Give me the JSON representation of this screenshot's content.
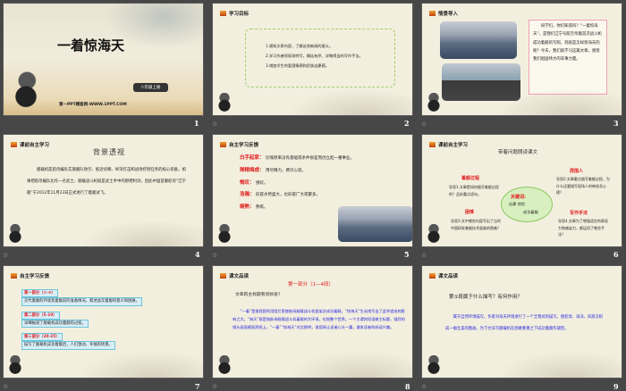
{
  "slides": [
    {
      "number": "1",
      "title": "一着惊海天",
      "grade": "八年级上册",
      "footer": "第一PPT模板网-WWW.1PPT.COM"
    },
    {
      "number": "2",
      "header": "学习目标",
      "items": [
        "1.感知文章内容，了解这则新闻的意义。",
        "2.学习作者抓现场特写，概括有序、详略得当的写作手法。",
        "3.增加学生的爱国情感和民族自豪感。"
      ]
    },
    {
      "number": "3",
      "header": "情景导入",
      "text": "同学们，你们知道吗？“一着惊海天”，是我们辽宁号航空母舰首次战斗机成功着舰的写照，到底是怎样惊海天的呢？今天，我们就学习这篇文章，感受我们祖国伟大的军事力量。"
    },
    {
      "number": "4",
      "header": "课前自主学习",
      "title": "背景透视",
      "text": "舰载机是航母编队实施舰队防空、抵近侦察、纵深打击和战场控制任务的核心装备，如果把航母编队比作一名武士，舰载战斗机就是武士手中的那把利剑，因此中国首艘航母“辽宁舰”于2012年11月23日正式进行了着舰试飞。"
    },
    {
      "number": "5",
      "header": "自主学习反馈",
      "terms": [
        {
          "term": "白手起家：",
          "def": "比喻原来没有基础或条件很差而创立起一番事业。"
        },
        {
          "term": "殚精竭虑：",
          "def": "用尽精力，费尽心思。"
        },
        {
          "term": "慨叹：",
          "def": "感叹。"
        },
        {
          "term": "浩瀚：",
          "def": "形容水势盛大，也形容广大或繁多。"
        },
        {
          "term": "娴熟：",
          "def": "熟练。"
        }
      ]
    },
    {
      "number": "6",
      "header": "课前自主学习",
      "title": "带着问题朗读课文",
      "center": "关键词:",
      "keys": [
        "自豪",
        "惊险",
        "成功",
        "着舰"
      ],
      "branches": [
        {
          "label": "着舰过程",
          "q": "导思1.文章是如何描写着舰过程的？品析重点语句。"
        },
        {
          "label": "周围人",
          "q": "导思2:文章重点描写着舰过程，为什么还要描写现场人的神态及心理？"
        },
        {
          "label": "困难",
          "q": "导思3.文中哪些内容写出了当时中国研发着舰技术面临的困难？"
        },
        {
          "label": "写作手法",
          "q": "导思4.文章为了增强语言的表现力和感染力，都运用了哪些手法？"
        }
      ]
    },
    {
      "number": "7",
      "header": "自主学习反馈",
      "parts": [
        {
          "label": "第一部分（①-④）",
          "desc": "交代着舰的环境及着舰前的准备情况，叙述此次着舰的意义和困难。"
        },
        {
          "label": "第二部分（5-19）",
          "desc": "详细报道了舰载机成功着舰的过程。"
        },
        {
          "label": "第三部分（20-25）",
          "desc": "描写了舰载机成功着舰后，人们激动、幸福的场景。"
        }
      ]
    },
    {
      "number": "8",
      "header": "课文品读",
      "title": "第一部分（1—4段）",
      "question": "文章的主标题有何妙处？",
      "answer": "“一着”是指我国利用阻拦索使航母舰载战斗机首架次成功着舰，“惊海天”生动地写出了此举造成的影响之大。“海天”既是指航母舰载战斗机着舰的大环境，也指整个世界。一个主谓宾短语做主标题，强烈的镜头画面感跃然纸上，“一着”“惊海天”对比鲜明，很容易让读者心头一震，激发读者的阅读兴趣。"
    },
    {
      "number": "9",
      "header": "课文品读",
      "question": "第①段属于什么描写？有何作用？",
      "answer": "属于自然环境描写。作者对海天环境进行了一个全景式的描写，使航母、海洋、风浪交织成一幅壮美的图画，为下文详写舰载机在困难重重之下成功着舰作铺垫。"
    }
  ],
  "colors": {
    "background": "#474747",
    "slide": "#f3efdf",
    "accent_red": "#e02020",
    "text_blue": "#2222dd"
  }
}
